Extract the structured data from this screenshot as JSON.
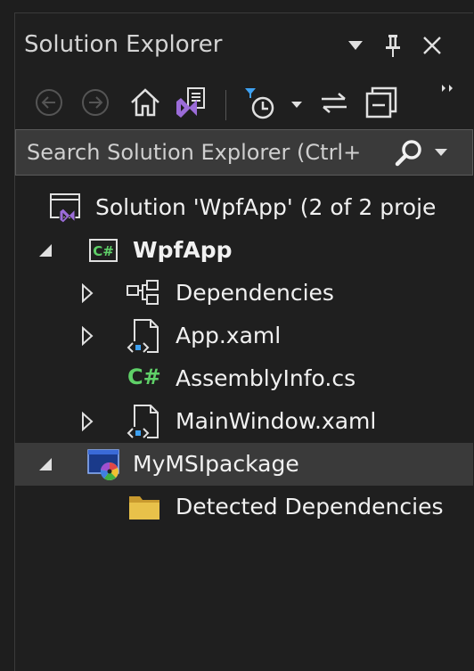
{
  "panel": {
    "title": "Solution Explorer",
    "controls": {
      "dropdown_icon": "triangle-down-icon",
      "pin_icon": "pin-icon",
      "close_icon": "close-icon"
    }
  },
  "toolbar": {
    "back_icon": "back-icon",
    "forward_icon": "forward-icon",
    "home_icon": "home-icon",
    "switch_views_icon": "vs-switch-views-icon",
    "pending_changes_icon": "pending-changes-filter-icon",
    "sync_icon": "sync-with-document-icon",
    "collapse_all_icon": "collapse-all-icon",
    "overflow_icon": "overflow-icon"
  },
  "search": {
    "placeholder": "Search Solution Explorer (Ctrl+",
    "search_icon": "search-icon",
    "dropdown_icon": "chevron-down-icon"
  },
  "tree": {
    "solution": {
      "label": "Solution 'WpfApp' (2 of 2 proje",
      "icon": "solution-icon"
    },
    "wpfapp": {
      "label": "WpfApp",
      "icon": "csharp-project-icon",
      "expanded": true
    },
    "dependencies": {
      "label": "Dependencies",
      "icon": "dependencies-icon"
    },
    "app_xaml": {
      "label": "App.xaml",
      "icon": "xaml-file-icon"
    },
    "assemblyinfo": {
      "label": "AssemblyInfo.cs",
      "icon": "csharp-file-icon",
      "glyph": "C#"
    },
    "mainwindow": {
      "label": "MainWindow.xaml",
      "icon": "xaml-file-icon"
    },
    "msi": {
      "label": "MyMSIpackage",
      "icon": "installer-project-icon",
      "selected": true
    },
    "detected": {
      "label": "Detected Dependencies",
      "icon": "folder-icon"
    }
  },
  "colors": {
    "background": "#1f1f1f",
    "selection": "#3a3a3a",
    "csharp_green": "#5fd068",
    "vs_purple": "#9b6cd8",
    "accent_blue": "#3ea1f2",
    "folder": "#e8c14a"
  }
}
